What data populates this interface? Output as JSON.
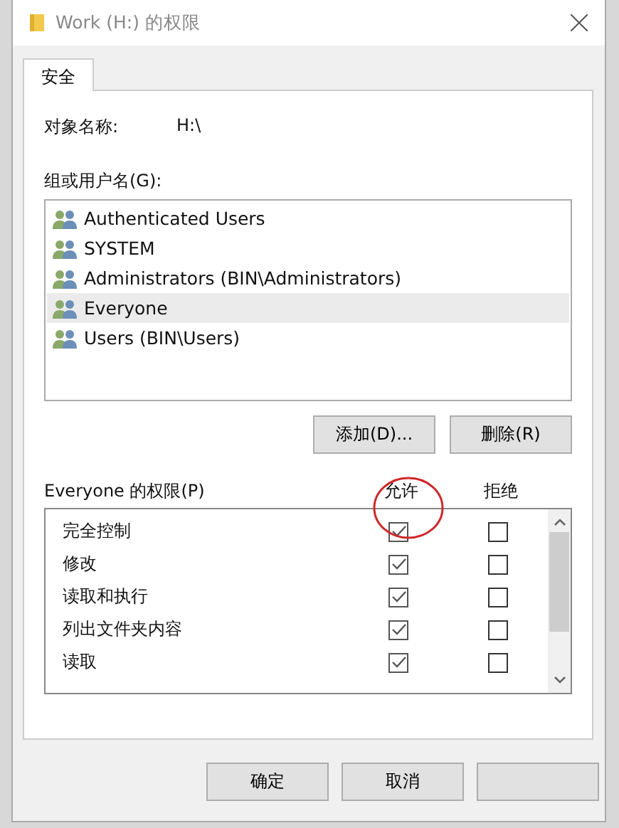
{
  "window": {
    "title": "Work (H:) 的权限"
  },
  "tabs": [
    {
      "label": "安全",
      "selected": true
    }
  ],
  "object_name": {
    "label": "对象名称:",
    "value": "H:\\"
  },
  "group_list": {
    "label": "组或用户名(G):",
    "items": [
      {
        "name": "Authenticated Users",
        "selected": false
      },
      {
        "name": "SYSTEM",
        "selected": false
      },
      {
        "name": "Administrators (BIN\\Administrators)",
        "selected": false
      },
      {
        "name": "Everyone",
        "selected": true
      },
      {
        "name": "Users (BIN\\Users)",
        "selected": false
      }
    ]
  },
  "group_buttons": [
    "添加(D)...",
    "删除(R)"
  ],
  "permissions": {
    "label": "Everyone 的权限(P)",
    "allow_header": "允许",
    "deny_header": "拒绝",
    "rows": [
      {
        "name": "完全控制",
        "allow": true,
        "deny": false
      },
      {
        "name": "修改",
        "allow": true,
        "deny": false
      },
      {
        "name": "读取和执行",
        "allow": true,
        "deny": false
      },
      {
        "name": "列出文件夹内容",
        "allow": true,
        "deny": false
      },
      {
        "name": "读取",
        "allow": true,
        "deny": false
      }
    ]
  },
  "dialog_buttons": [
    "确定",
    "取消"
  ]
}
